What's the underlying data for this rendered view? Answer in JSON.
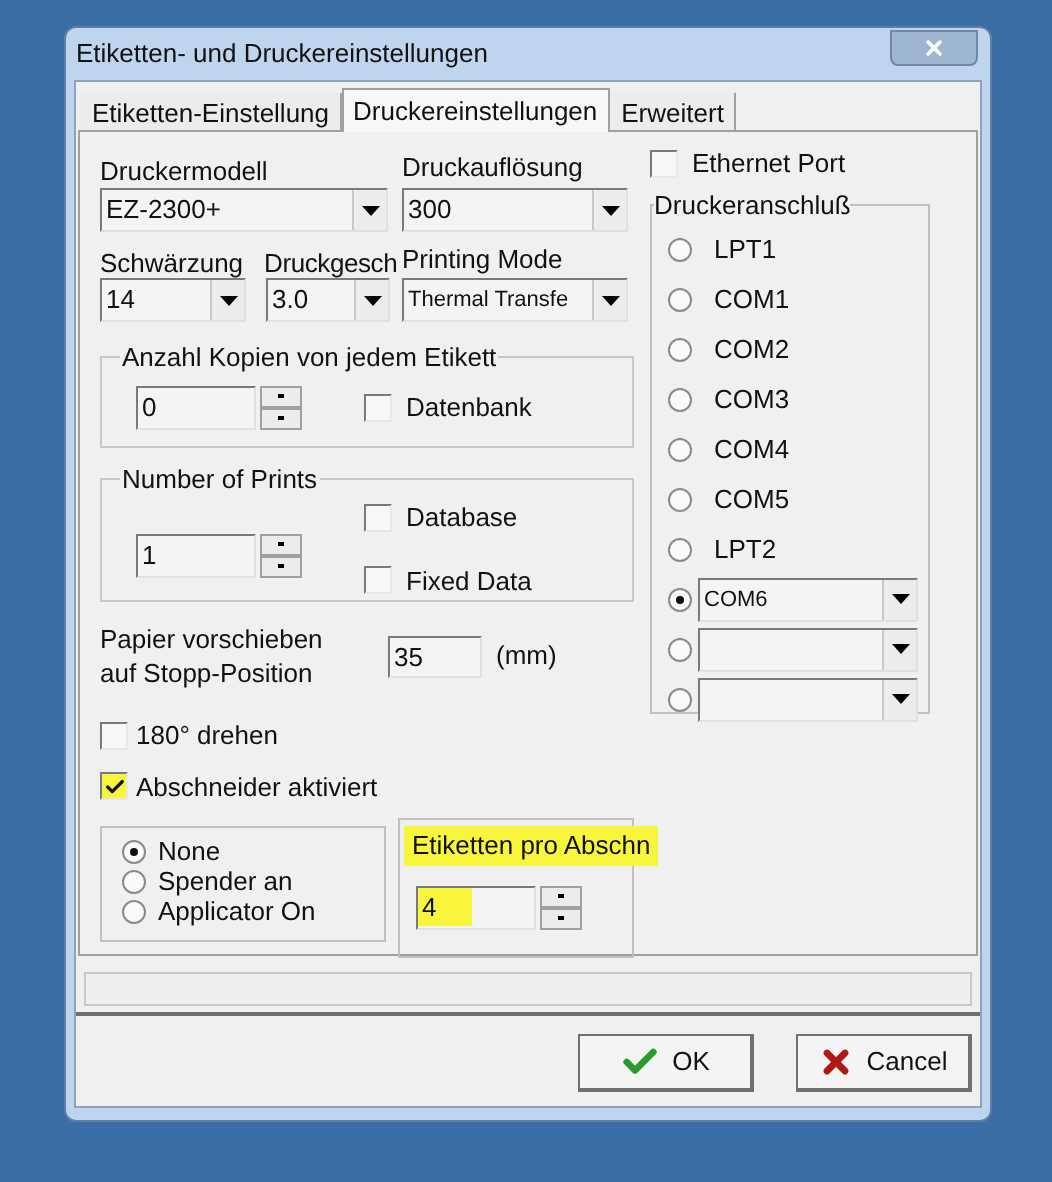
{
  "window": {
    "title": "Etiketten- und Druckereinstellungen"
  },
  "tabs": [
    {
      "label": "Etiketten-Einstellung",
      "selected": false
    },
    {
      "label": "Druckereinstellungen",
      "selected": true
    },
    {
      "label": "Erweitert",
      "selected": false
    }
  ],
  "printer_model": {
    "label": "Druckermodell",
    "value": "EZ-2300+"
  },
  "resolution": {
    "label": "Druckauflösung",
    "value": "300"
  },
  "darkness": {
    "label": "Schwärzung",
    "value": "14"
  },
  "speed": {
    "label": "Druckgesch",
    "value": "3.0"
  },
  "printing_mode": {
    "label": "Printing Mode",
    "value": "Thermal Transfe"
  },
  "copies_group": {
    "title": "Anzahl Kopien von jedem Etikett",
    "value": "0",
    "checkboxes": [
      {
        "label": "Datenbank",
        "checked": false
      }
    ]
  },
  "prints_group": {
    "title": "Number of Prints",
    "value": "1",
    "checkboxes": [
      {
        "label": "Database",
        "checked": false
      },
      {
        "label": "Fixed Data",
        "checked": false
      }
    ]
  },
  "paper_feed": {
    "label": "Papier vorschieben auf Stopp-Position",
    "value": "35",
    "unit": "(mm)"
  },
  "options": [
    {
      "label": "180° drehen",
      "checked": false,
      "highlighted": false
    },
    {
      "label": "Abschneider aktiviert",
      "checked": true,
      "highlighted": true
    }
  ],
  "mode_radios": [
    {
      "label": "None",
      "selected": true
    },
    {
      "label": "Spender an",
      "selected": false
    },
    {
      "label": "Applicator On",
      "selected": false
    }
  ],
  "labels_per_cut": {
    "title": "Etiketten pro Abschn",
    "value": "4",
    "highlighted": true
  },
  "ethernet_port": {
    "label": "Ethernet Port",
    "checked": false
  },
  "printer_port": {
    "title": "Druckeranschluß",
    "ports": [
      {
        "kind": "radio",
        "label": "LPT1",
        "selected": false
      },
      {
        "kind": "radio",
        "label": "COM1",
        "selected": false
      },
      {
        "kind": "radio",
        "label": "COM2",
        "selected": false
      },
      {
        "kind": "radio",
        "label": "COM3",
        "selected": false
      },
      {
        "kind": "radio",
        "label": "COM4",
        "selected": false
      },
      {
        "kind": "radio",
        "label": "COM5",
        "selected": false
      },
      {
        "kind": "radio",
        "label": "LPT2",
        "selected": false
      },
      {
        "kind": "combo",
        "value": "COM6",
        "selected": true
      },
      {
        "kind": "combo",
        "selected": false
      },
      {
        "kind": "combo",
        "selected": false
      }
    ]
  },
  "buttons": [
    {
      "kind": "ok",
      "label": "OK"
    },
    {
      "kind": "cancel",
      "label": "Cancel"
    }
  ]
}
